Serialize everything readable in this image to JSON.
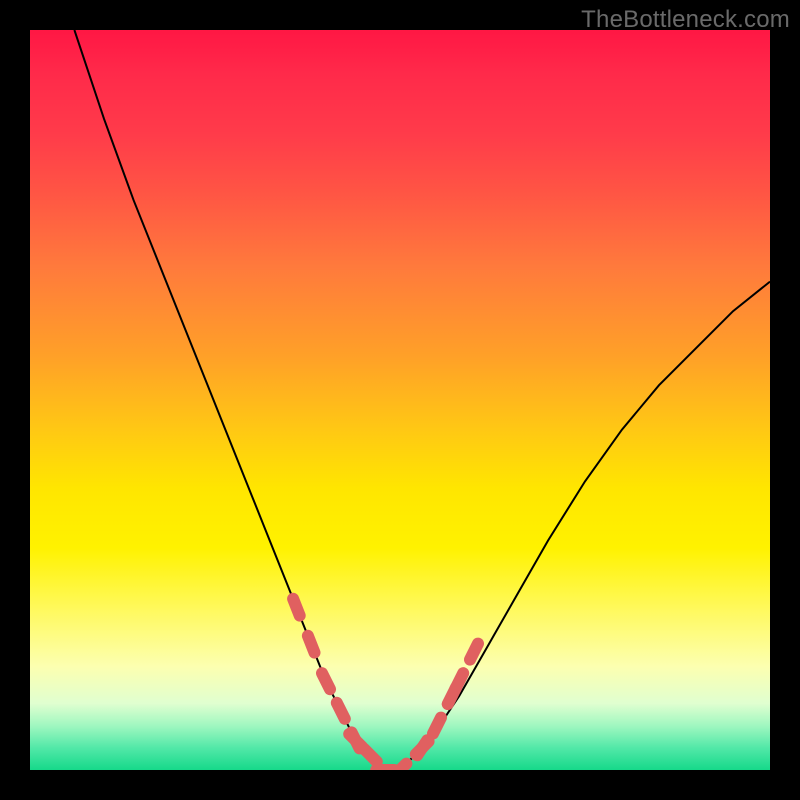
{
  "watermark": {
    "text": "TheBottleneck.com"
  },
  "colors": {
    "page_bg": "#000000",
    "curve_stroke": "#000000",
    "highlight_stroke": "#e06060",
    "gradient_top": "#ff1744",
    "gradient_mid": "#ffe600",
    "gradient_bottom": "#16d98a"
  },
  "chart_data": {
    "type": "line",
    "title": "",
    "xlabel": "",
    "ylabel": "",
    "xlim": [
      0,
      100
    ],
    "ylim": [
      0,
      100
    ],
    "grid": false,
    "legend": false,
    "series": [
      {
        "name": "bottleneck-curve",
        "x": [
          6,
          10,
          14,
          18,
          22,
          26,
          28,
          30,
          32,
          34,
          36,
          38,
          40,
          42,
          44,
          46,
          48,
          50,
          54,
          58,
          62,
          66,
          70,
          75,
          80,
          85,
          90,
          95,
          100
        ],
        "y": [
          100,
          88,
          77,
          67,
          57,
          47,
          42,
          37,
          32,
          27,
          22,
          17,
          12,
          8,
          4,
          2,
          0,
          0,
          4,
          10,
          17,
          24,
          31,
          39,
          46,
          52,
          57,
          62,
          66
        ]
      }
    ],
    "annotations": [
      {
        "name": "valley-highlight",
        "style": "dotted",
        "segments": [
          {
            "x": [
              36,
              38,
              40,
              42,
              44
            ],
            "y": [
              22,
              17,
              12,
              8,
              4
            ]
          },
          {
            "x": [
              44,
              46,
              48,
              50,
              53
            ],
            "y": [
              4,
              2,
              0,
              0,
              3
            ]
          },
          {
            "x": [
              53,
              55,
              57
            ],
            "y": [
              3,
              6,
              10
            ]
          },
          {
            "x": [
              57,
              58,
              60
            ],
            "y": [
              10,
              12,
              16
            ]
          }
        ]
      }
    ]
  }
}
